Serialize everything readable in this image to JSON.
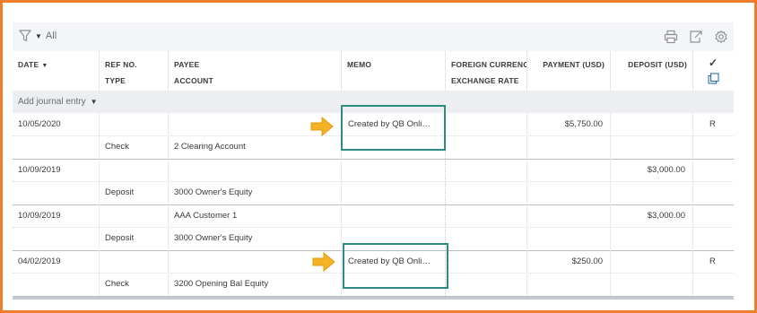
{
  "toolbar": {
    "filter_label": "All",
    "icons": [
      "filter-icon",
      "print-icon",
      "export-icon",
      "settings-icon"
    ]
  },
  "columns": {
    "date": "DATE",
    "ref_no": "REF NO.",
    "type": "TYPE",
    "payee": "PAYEE",
    "account": "ACCOUNT",
    "memo": "MEMO",
    "foreign_currency": "FOREIGN CURRENCY",
    "exchange_rate": "EXCHANGE RATE",
    "payment": "PAYMENT (USD)",
    "deposit": "DEPOSIT (USD)",
    "check_icon": "✓"
  },
  "add_entry": {
    "label": "Add journal entry"
  },
  "rows": [
    {
      "date": "10/05/2020",
      "ref": "",
      "type": "Check",
      "payee": "",
      "account": "2 Clearing Account",
      "memo": "Created by QB Onli…",
      "payment": "$5,750.00",
      "deposit": "",
      "status": "R"
    },
    {
      "date": "10/09/2019",
      "ref": "",
      "type": "Deposit",
      "payee": "",
      "account": "3000 Owner's Equity",
      "memo": "",
      "payment": "",
      "deposit": "$3,000.00",
      "status": ""
    },
    {
      "date": "10/09/2019",
      "ref": "",
      "type": "Deposit",
      "payee": "AAA Customer 1",
      "account": "3000 Owner's Equity",
      "memo": "",
      "payment": "",
      "deposit": "$3,000.00",
      "status": ""
    },
    {
      "date": "04/02/2019",
      "ref": "",
      "type": "Check",
      "payee": "",
      "account": "3200 Opening Bal Equity",
      "memo": "Created by QB Onli…",
      "payment": "$250.00",
      "deposit": "",
      "status": "R"
    }
  ],
  "colors": {
    "frame": "#ef7d2b",
    "highlight": "#2e8b84",
    "arrow": "#f5b324"
  }
}
